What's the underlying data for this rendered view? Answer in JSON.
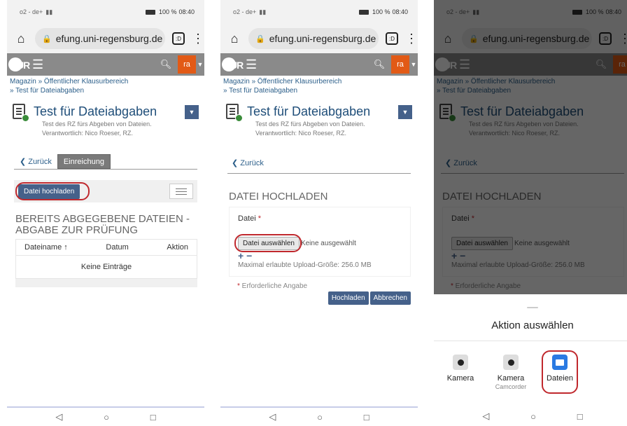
{
  "status": {
    "left": "o2 - de+",
    "right": "100 %",
    "time": "08:40"
  },
  "browser": {
    "url": "efung.uni-regensburg.de",
    "tabs_count": ":D"
  },
  "nav": {
    "logo": "UR",
    "user": "ra"
  },
  "breadcrumb": {
    "line1": "Magazin  »  Öffentlicher Klausurbereich",
    "line2": "»  Test für Dateiabgaben"
  },
  "page": {
    "title": "Test für Dateiabgaben",
    "desc1": "Test des RZ fürs Abgeben von Dateien.",
    "desc2": "Verantwortlich: Nico Roeser, RZ."
  },
  "screen1": {
    "back": "Zurück",
    "tab_active": "Einreichung",
    "upload_button": "Datei hochladen",
    "section": "BEREITS ABGEGEBENE DATEIEN - ABGABE ZUR PRÜFUNG",
    "columns": {
      "name": "Dateiname ↑",
      "date": "Datum",
      "action": "Aktion"
    },
    "empty": "Keine Einträge"
  },
  "screen2": {
    "back": "Zurück",
    "section": "DATEI HOCHLADEN",
    "field_label": "Datei",
    "required_mark": "*",
    "choose_button": "Datei auswählen",
    "no_file": "Keine ausgewählt",
    "plusminus": "+ −",
    "max_size": "Maximal erlaubte Upload-Größe: 256.0 MB",
    "required_note": "Erforderliche Angabe",
    "submit": "Hochladen",
    "cancel": "Abbrechen"
  },
  "sheet": {
    "title": "Aktion auswählen",
    "apps": [
      {
        "label": "Kamera",
        "sub": ""
      },
      {
        "label": "Kamera",
        "sub": "Camcorder"
      },
      {
        "label": "Dateien",
        "sub": ""
      }
    ]
  },
  "android_nav": {
    "back": "◁",
    "home": "○",
    "recents": "□"
  },
  "colors": {
    "accent": "#45618a",
    "user_badge": "#e25a16",
    "highlight_ring": "#c0282d",
    "files_app": "#2a7ae2"
  }
}
